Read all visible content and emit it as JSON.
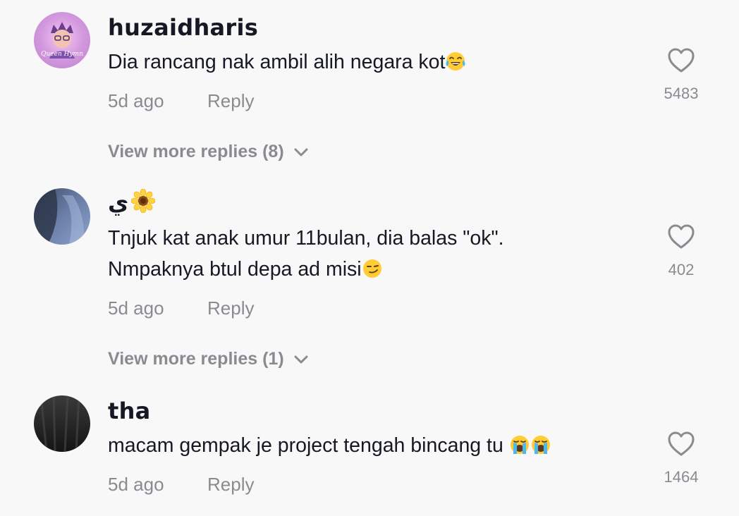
{
  "comments": [
    {
      "username": "huzaidharis",
      "text": "Dia rancang nak ambil alih negara kot",
      "emoji": [
        "face-with-tears-of-joy"
      ],
      "time": "5d ago",
      "reply_label": "Reply",
      "likes": "5483",
      "view_more": "View more replies (8)"
    },
    {
      "username": "ي",
      "username_emoji": "sunflower",
      "text_line1": "Tnjuk kat anak umur 11bulan, dia balas \"ok\".",
      "text_line2": "Nmpaknya btul depa ad misi",
      "emoji": [
        "smirking-face"
      ],
      "time": "5d ago",
      "reply_label": "Reply",
      "likes": "402",
      "view_more": "View more replies (1)"
    },
    {
      "username": "tha",
      "text": "macam gempak je project tengah bincang tu ",
      "emoji": [
        "loudly-crying-face",
        "loudly-crying-face"
      ],
      "time": "5d ago",
      "reply_label": "Reply",
      "likes": "1464"
    }
  ],
  "icons": {
    "like": "heart-outline-icon",
    "expand": "chevron-down-icon"
  },
  "colors": {
    "background": "#f8f8f8",
    "primary_text": "#161823",
    "secondary_text": "#8a8b91"
  }
}
